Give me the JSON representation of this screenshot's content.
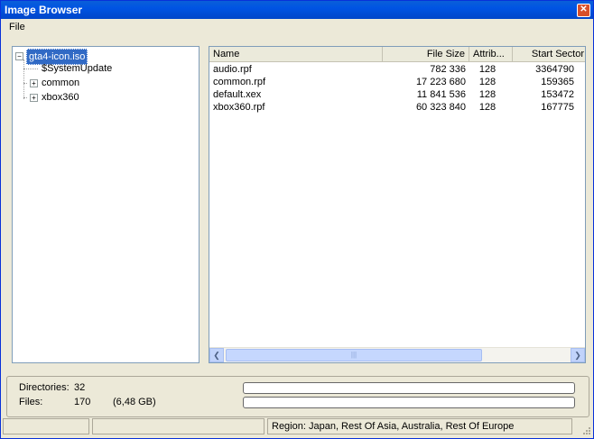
{
  "window": {
    "title": "Image Browser"
  },
  "menu": {
    "file_label": "File"
  },
  "tree": {
    "root_label": "gta4-icon.iso",
    "items": [
      {
        "label": "$SystemUpdate",
        "expandable": false
      },
      {
        "label": "common",
        "expandable": true
      },
      {
        "label": "xbox360",
        "expandable": true
      }
    ]
  },
  "list": {
    "columns": [
      "Name",
      "File Size",
      "Attrib...",
      "Start Sector"
    ],
    "rows": [
      {
        "name": "audio.rpf",
        "size": "782 336",
        "attrib": "128",
        "sector": "3364790"
      },
      {
        "name": "common.rpf",
        "size": "17 223 680",
        "attrib": "128",
        "sector": "159365"
      },
      {
        "name": "default.xex",
        "size": "11 841 536",
        "attrib": "128",
        "sector": "153472"
      },
      {
        "name": "xbox360.rpf",
        "size": "60 323 840",
        "attrib": "128",
        "sector": "167775"
      }
    ]
  },
  "info": {
    "directories_label": "Directories:",
    "directories_value": "32",
    "files_label": "Files:",
    "files_value": "170",
    "files_size": "(6,48 GB)"
  },
  "status": {
    "region": "Region: Japan, Rest Of Asia, Australia, Rest Of Europe"
  }
}
